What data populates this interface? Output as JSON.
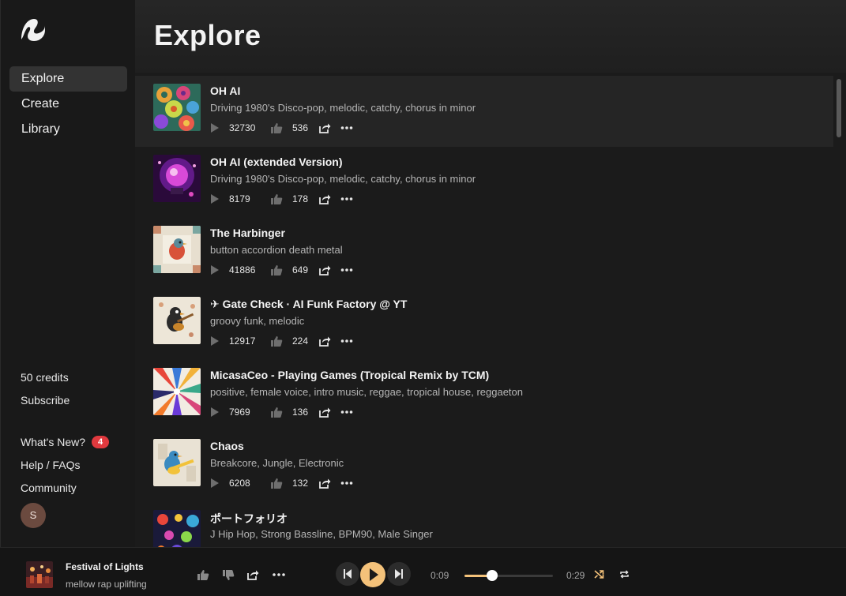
{
  "colors": {
    "accent": "#f4c27a",
    "badge": "#e0393e",
    "background": "#1b1b1b",
    "sidebar": "#191919"
  },
  "sidebar": {
    "logo_icon": "wave-logo-icon",
    "nav": [
      {
        "label": "Explore",
        "active": true
      },
      {
        "label": "Create",
        "active": false
      },
      {
        "label": "Library",
        "active": false
      }
    ],
    "credits": "50 credits",
    "subscribe": "Subscribe",
    "whats_new": "What's New?",
    "whats_new_badge": "4",
    "help": "Help / FAQs",
    "community": "Community",
    "avatar_initial": "S"
  },
  "main": {
    "title": "Explore",
    "songs": [
      {
        "title": "OH AI",
        "tags": "Driving 1980's Disco-pop, melodic, catchy, chorus in minor",
        "plays": "32730",
        "likes": "536",
        "art": "gears-art"
      },
      {
        "title": "OH AI (extended Version)",
        "tags": "Driving 1980's Disco-pop, melodic, catchy, chorus in minor",
        "plays": "8179",
        "likes": "178",
        "art": "disco-ball-art"
      },
      {
        "title": "The Harbinger",
        "tags": "button accordion death metal",
        "plays": "41886",
        "likes": "649",
        "art": "bird-pattern-art"
      },
      {
        "title": "✈ Gate Check · AI Funk Factory @ YT",
        "tags": "groovy funk, melodic",
        "plays": "12917",
        "likes": "224",
        "art": "bird-guitar-art"
      },
      {
        "title": "MicasaCeo - Playing Games (Tropical Remix by TCM)",
        "tags": "positive, female voice, intro music, reggae, tropical house, reggaeton",
        "plays": "7969",
        "likes": "136",
        "art": "color-burst-art"
      },
      {
        "title": "Chaos",
        "tags": "Breakcore, Jungle, Electronic",
        "plays": "6208",
        "likes": "132",
        "art": "bird-guitar-yellow-art"
      },
      {
        "title": "ポートフォリオ",
        "tags": "J Hip Hop, Strong Bassline, BPM90, Male Singer",
        "plays": "",
        "likes": "",
        "art": "dots-art"
      }
    ]
  },
  "player": {
    "title": "Festival of Lights",
    "tags": "mellow rap uplifting",
    "current_time": "0:09",
    "total_time": "0:29",
    "progress": 0.31
  }
}
